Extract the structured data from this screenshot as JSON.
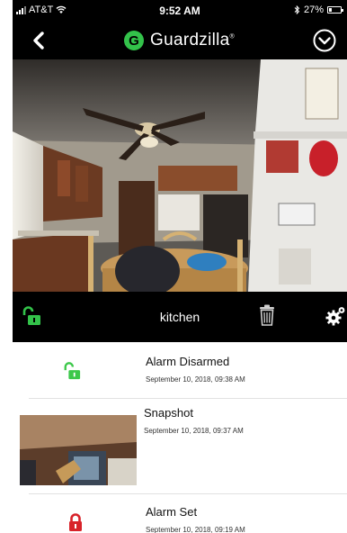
{
  "status_bar": {
    "carrier": "AT&T",
    "time": "9:52 AM",
    "battery": "27%",
    "battery_level": 0.27,
    "icons": [
      "signal-icon",
      "wifi-icon",
      "bluetooth-icon",
      "battery-icon"
    ]
  },
  "nav": {
    "logo_letter": "G",
    "brand": "Guardzilla",
    "trademark": "®",
    "icons": [
      "back-chevron-icon",
      "collapse-chevron-icon"
    ]
  },
  "camera_bar": {
    "name": "kitchen",
    "icons": [
      "unlocked-padlock-icon",
      "trash-icon",
      "gear-icon"
    ]
  },
  "events": [
    {
      "type": "status",
      "title": "Alarm Disarmed",
      "time": "September 10, 2018, 09:38 AM",
      "icon": "unlocked-padlock-icon",
      "icon_color": "#3cc84a"
    },
    {
      "type": "snapshot",
      "title": "Snapshot",
      "time": "September 10, 2018, 09:37 AM"
    },
    {
      "type": "status",
      "title": "Alarm Set",
      "time": "September 10, 2018, 09:19 AM",
      "icon": "locked-padlock-icon",
      "icon_color": "#d8232a"
    }
  ],
  "colors": {
    "accent": "#33c24a",
    "alarm_red": "#d8232a",
    "bar": "#000000"
  }
}
